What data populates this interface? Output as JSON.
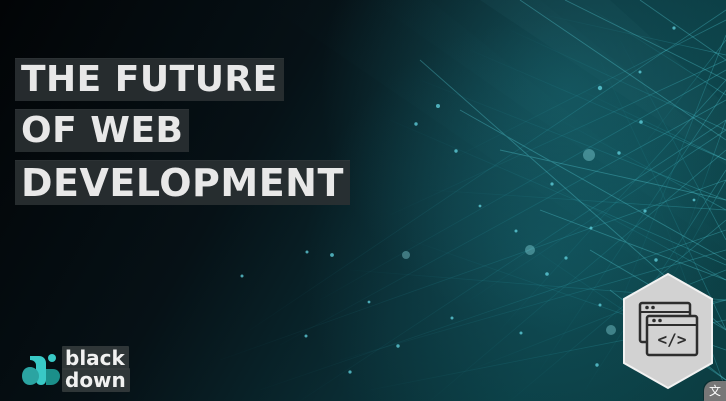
{
  "title": {
    "line1": "THE FUTURE",
    "line2": "OF WEB",
    "line3": "DEVELOPMENT"
  },
  "logo": {
    "line1": "black",
    "line2": "down"
  },
  "badge": {
    "icon": "code-window-icon",
    "code_text": "</>"
  },
  "corner": {
    "glyph": "文"
  },
  "colors": {
    "background_dark": "#020406",
    "background_teal": "#0a3a40",
    "accent_cyan": "#3ec8d8",
    "title_bg": "#2b3133",
    "title_text": "#e8e8e8",
    "badge_bg": "#cfcfcf",
    "logo_cyan": "#39c9c6",
    "logo_teal": "#1b8f8a"
  }
}
